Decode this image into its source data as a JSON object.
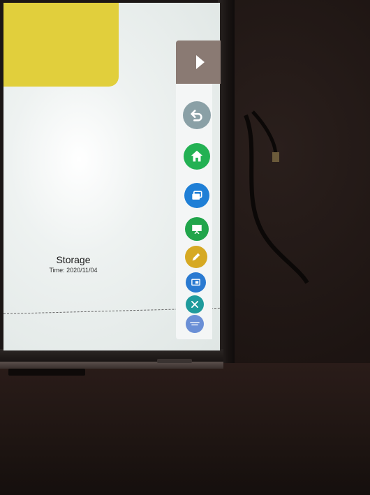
{
  "screen": {
    "storage": {
      "title": "Storage",
      "time": "Time: 2020/11/04"
    }
  },
  "sidebar": {
    "collapse": {
      "icon": "chevron-right-icon"
    },
    "buttons": [
      {
        "name": "back",
        "icon": "back-arrow-icon",
        "color": "#8aa0a6"
      },
      {
        "name": "home",
        "icon": "home-icon",
        "color": "#23b153"
      },
      {
        "name": "windows",
        "icon": "windows-icon",
        "color": "#1f7fd6"
      },
      {
        "name": "whiteboard",
        "icon": "whiteboard-icon",
        "color": "#21a54b"
      },
      {
        "name": "annotate",
        "icon": "pen-icon",
        "color": "#d6a923"
      },
      {
        "name": "screen",
        "icon": "screen-icon",
        "color": "#2a7ad1"
      },
      {
        "name": "tools",
        "icon": "tools-icon",
        "color": "#1f9b9c"
      },
      {
        "name": "more",
        "icon": "more-icon",
        "color": "#6a8fd6"
      }
    ]
  },
  "colors": {
    "card_yellow": "#e1cf3c",
    "sidebar_tab": "#8a7a73",
    "screen_bg": "#eef2f1"
  }
}
